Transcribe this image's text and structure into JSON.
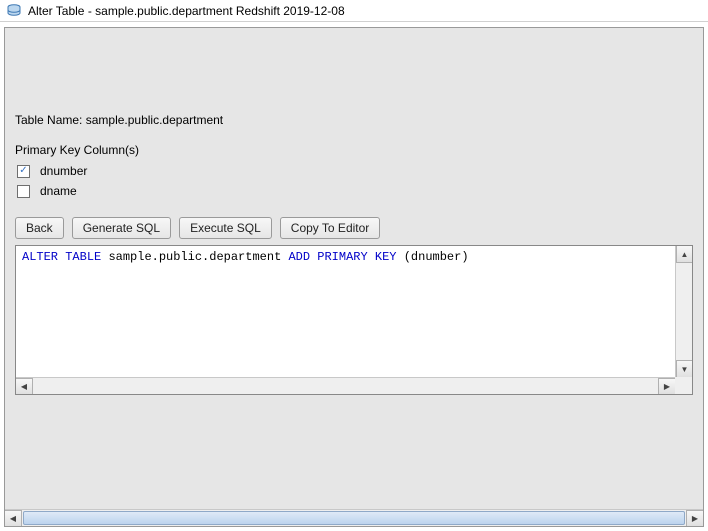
{
  "window": {
    "title": "Alter Table - sample.public.department Redshift 2019-12-08"
  },
  "tableName": {
    "label": "Table Name:",
    "value": "sample.public.department"
  },
  "primaryKey": {
    "label": "Primary Key Column(s)",
    "columns": [
      {
        "name": "dnumber",
        "checked": true
      },
      {
        "name": "dname",
        "checked": false
      }
    ]
  },
  "buttons": {
    "back": "Back",
    "generate": "Generate SQL",
    "execute": "Execute SQL",
    "copy": "Copy To Editor"
  },
  "sql": {
    "kw1": "ALTER",
    "kw2": "TABLE",
    "obj": "sample.public.department",
    "kw3": "ADD",
    "kw4": "PRIMARY",
    "kw5": "KEY",
    "args": "(dnumber)"
  }
}
